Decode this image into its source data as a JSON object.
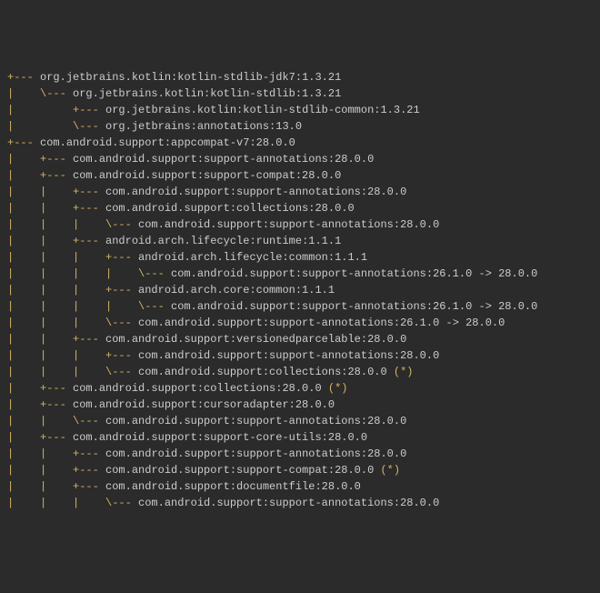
{
  "lines": [
    {
      "tree": "+--- ",
      "text": "org.jetbrains.kotlin:kotlin-stdlib-jdk7:1.3.21"
    },
    {
      "tree": "|    \\--- ",
      "text": "org.jetbrains.kotlin:kotlin-stdlib:1.3.21"
    },
    {
      "tree": "|         +--- ",
      "text": "org.jetbrains.kotlin:kotlin-stdlib-common:1.3.21"
    },
    {
      "tree": "|         \\--- ",
      "text": "org.jetbrains:annotations:13.0"
    },
    {
      "tree": "+--- ",
      "text": "com.android.support:appcompat-v7:28.0.0"
    },
    {
      "tree": "|    +--- ",
      "text": "com.android.support:support-annotations:28.0.0"
    },
    {
      "tree": "|    +--- ",
      "text": "com.android.support:support-compat:28.0.0"
    },
    {
      "tree": "|    |    +--- ",
      "text": "com.android.support:support-annotations:28.0.0"
    },
    {
      "tree": "|    |    +--- ",
      "text": "com.android.support:collections:28.0.0"
    },
    {
      "tree": "|    |    |    \\--- ",
      "text": "com.android.support:support-annotations:28.0.0"
    },
    {
      "tree": "|    |    +--- ",
      "text": "android.arch.lifecycle:runtime:1.1.1"
    },
    {
      "tree": "|    |    |    +--- ",
      "text": "android.arch.lifecycle:common:1.1.1"
    },
    {
      "tree": "|    |    |    |    \\--- ",
      "text": "com.android.support:support-annotations:26.1.0 -> 28.0.0"
    },
    {
      "tree": "|    |    |    +--- ",
      "text": "android.arch.core:common:1.1.1"
    },
    {
      "tree": "|    |    |    |    \\--- ",
      "text": "com.android.support:support-annotations:26.1.0 -> 28.0.0"
    },
    {
      "tree": "|    |    |    \\--- ",
      "text": "com.android.support:support-annotations:26.1.0 -> 28.0.0"
    },
    {
      "tree": "|    |    +--- ",
      "text": "com.android.support:versionedparcelable:28.0.0"
    },
    {
      "tree": "|    |    |    +--- ",
      "text": "com.android.support:support-annotations:28.0.0"
    },
    {
      "tree": "|    |    |    \\--- ",
      "text": "com.android.support:collections:28.0.0 ",
      "marker": "(*)"
    },
    {
      "tree": "|    +--- ",
      "text": "com.android.support:collections:28.0.0 ",
      "marker": "(*)"
    },
    {
      "tree": "|    +--- ",
      "text": "com.android.support:cursoradapter:28.0.0"
    },
    {
      "tree": "|    |    \\--- ",
      "text": "com.android.support:support-annotations:28.0.0"
    },
    {
      "tree": "|    +--- ",
      "text": "com.android.support:support-core-utils:28.0.0"
    },
    {
      "tree": "|    |    +--- ",
      "text": "com.android.support:support-annotations:28.0.0"
    },
    {
      "tree": "|    |    +--- ",
      "text": "com.android.support:support-compat:28.0.0 ",
      "marker": "(*)"
    },
    {
      "tree": "|    |    +--- ",
      "text": "com.android.support:documentfile:28.0.0"
    },
    {
      "tree": "|    |    |    \\--- ",
      "text": "com.android.support:support-annotations:28.0.0"
    }
  ]
}
